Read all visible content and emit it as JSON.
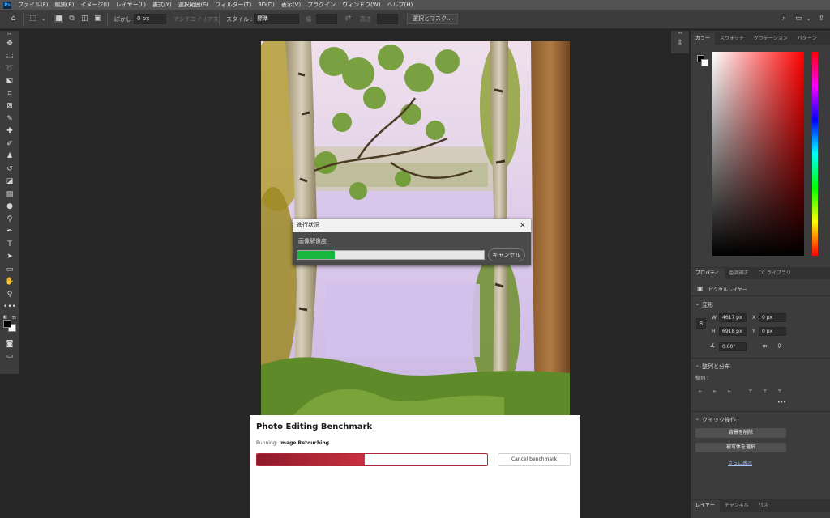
{
  "menubar": {
    "app_icon": "Ps",
    "items": [
      "ファイル(F)",
      "編集(E)",
      "イメージ(I)",
      "レイヤー(L)",
      "書式(Y)",
      "選択範囲(S)",
      "フィルター(T)",
      "3D(D)",
      "表示(V)",
      "プラグイン",
      "ウィンドウ(W)",
      "ヘルプ(H)"
    ]
  },
  "options": {
    "feather_label": "ぼかし :",
    "feather_value": "0 px",
    "antialias_label": "アンチエイリアス",
    "style_label": "スタイル :",
    "style_value": "標準",
    "width_label": "幅",
    "height_label": "高さ",
    "select_mask_label": "選択とマスク..."
  },
  "progress_dialog": {
    "title": "進行状況",
    "caption": "画像解像度",
    "progress": 0.2,
    "cancel_label": "キャンセル"
  },
  "benchmark": {
    "title": "Photo Editing Benchmark",
    "running_prefix": "Running:",
    "running_task": "Image Retouching",
    "progress": 0.47,
    "cancel_label": "Cancel benchmark"
  },
  "color_panel": {
    "tabs": [
      "カラー",
      "スウォッチ",
      "グラデーション",
      "パターン"
    ]
  },
  "properties_panel": {
    "tabs": [
      "プロパティ",
      "色調補正",
      "CC ライブラリ"
    ],
    "layer_type": "ピクセルレイヤー",
    "transform_title": "変形",
    "w_label": "W",
    "w_value": "4617 px",
    "x_label": "X",
    "x_value": "0 px",
    "h_label": "H",
    "h_value": "6918 px",
    "y_label": "Y",
    "y_value": "0 px",
    "angle_value": "0.00°",
    "align_title": "整列と分布",
    "align_label": "整列 :",
    "more": "•••",
    "quick_title": "クイック操作",
    "remove_bg": "背景を削除",
    "select_subject": "被写体を選択",
    "see_more": "さらに表示"
  },
  "layers_panel": {
    "tabs": [
      "レイヤー",
      "チャンネル",
      "パス"
    ]
  },
  "colors": {
    "progress_green": "#16b73c",
    "benchmark_red": "#b02736"
  }
}
